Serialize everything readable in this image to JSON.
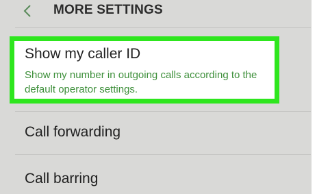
{
  "header": {
    "back_icon": "chevron-left-icon",
    "title": "MORE SETTINGS"
  },
  "settings": {
    "caller_id": {
      "title": "Show my caller ID",
      "subtitle": "Show my number in outgoing calls according to the default operator settings.",
      "highlighted": true
    },
    "items": [
      {
        "label": "Call forwarding"
      },
      {
        "label": "Call barring"
      }
    ]
  },
  "colors": {
    "background": "#d9d9d7",
    "highlight_border": "#2ee61e",
    "subtitle_text": "#3d8f3a",
    "primary_text": "#1f1f1f"
  }
}
